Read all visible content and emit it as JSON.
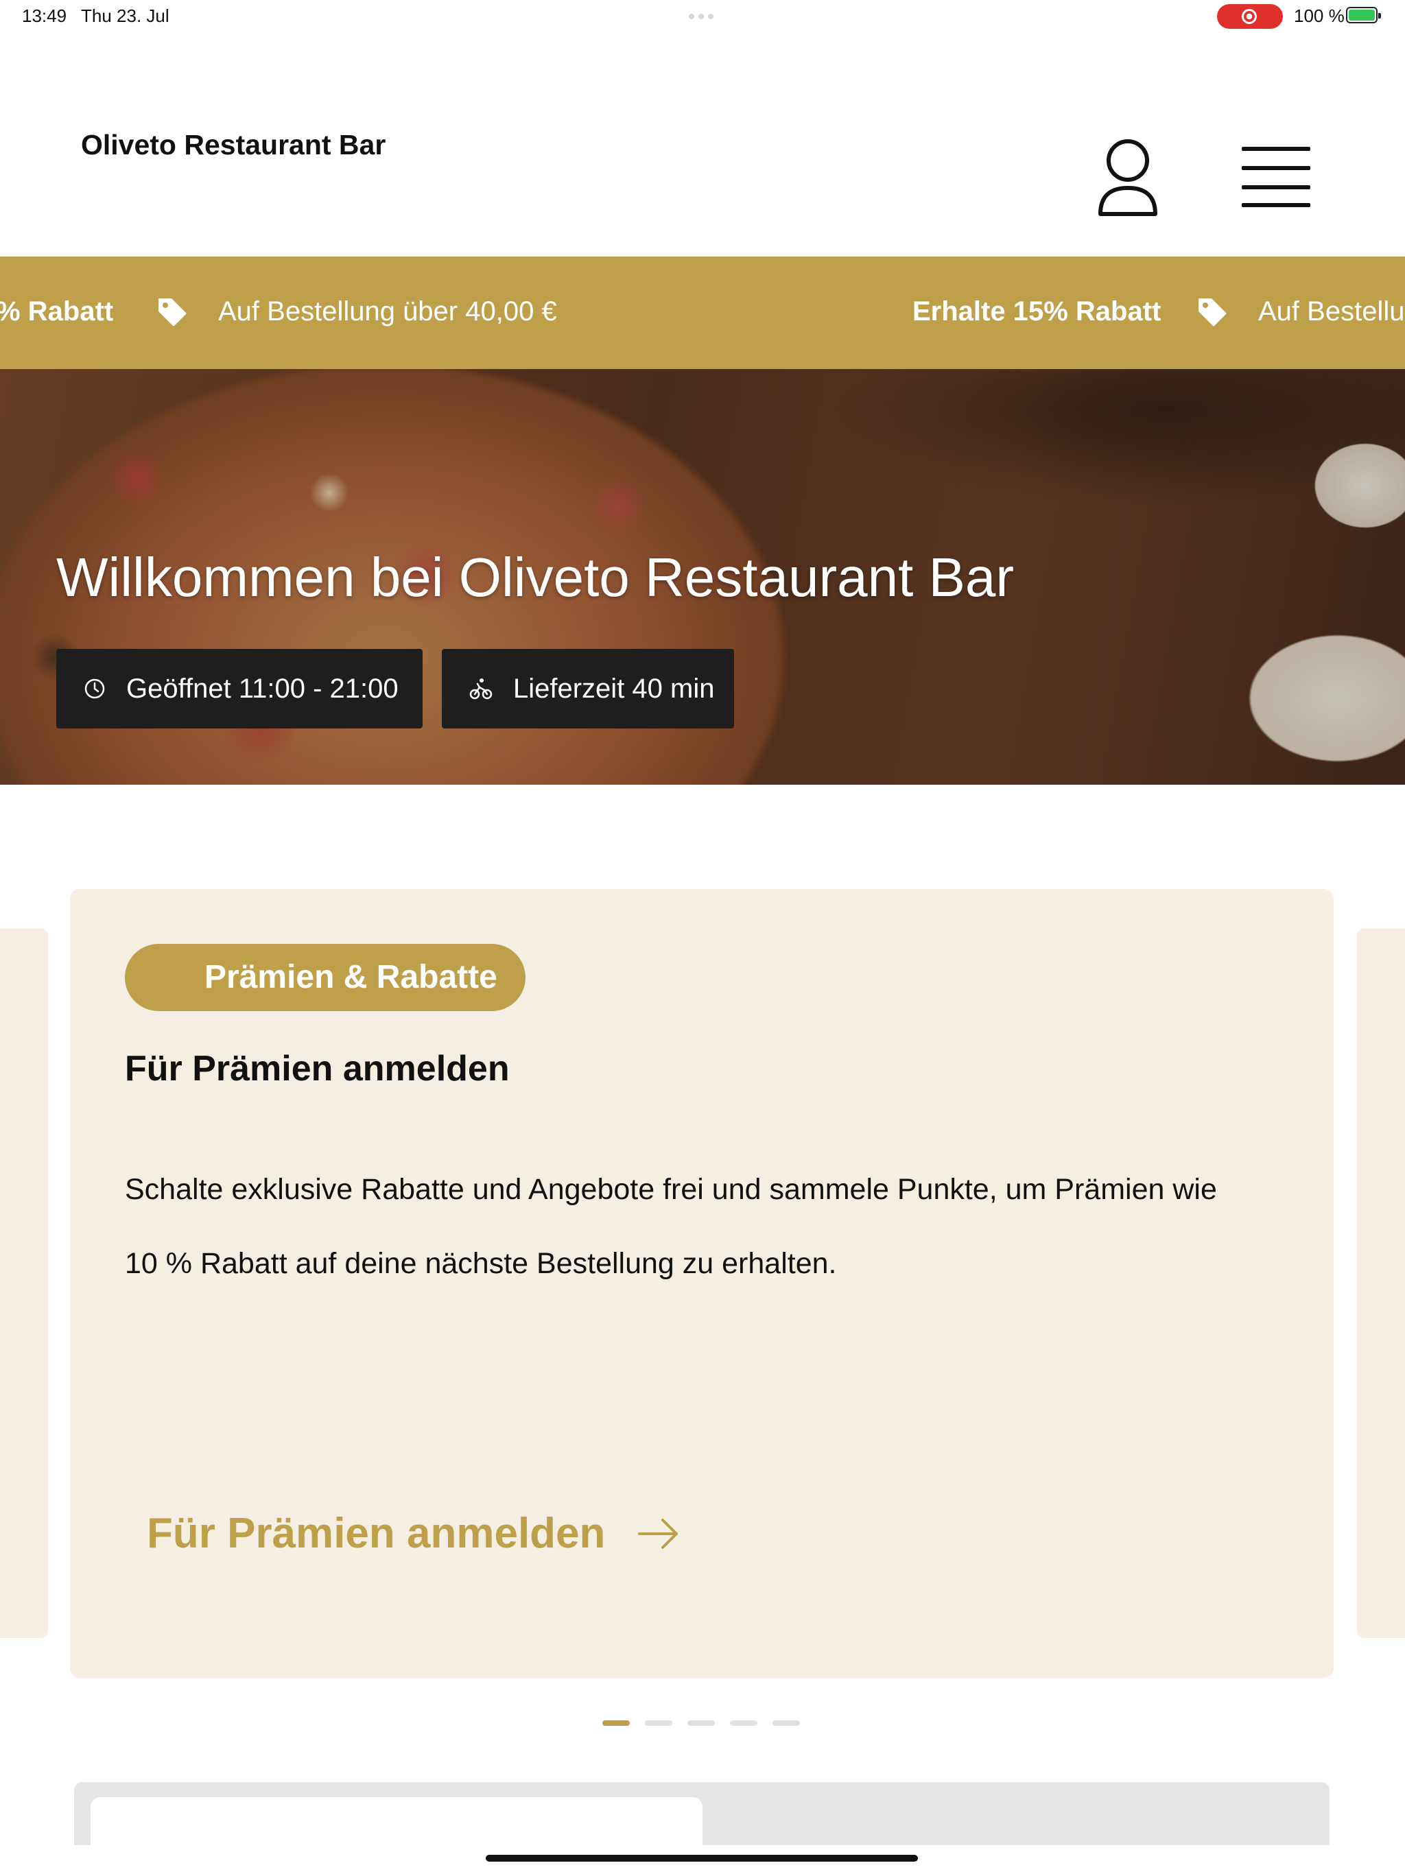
{
  "status_bar": {
    "time": "13:49",
    "date": "Thu 23. Jul",
    "battery": "100 %"
  },
  "header": {
    "brand": "Oliveto Restaurant Bar",
    "icons": [
      "user-icon",
      "menu-icon"
    ]
  },
  "ticker": {
    "items": [
      {
        "bold": "% Rabatt",
        "text": "Auf Bestellung über 40,00 €"
      },
      {
        "bold": "Erhalte 15% Rabatt",
        "text": "Auf Bestellu"
      }
    ]
  },
  "hero": {
    "title": "Willkommen bei Oliveto Restaurant Bar",
    "opening_hours": "Geöffnet 11:00 - 21:00",
    "delivery_time": "Lieferzeit 40 min"
  },
  "rewards_card": {
    "badge": "Prämien & Rabatte",
    "title": "Für Prämien anmelden",
    "body_line1": "Schalte exklusive Rabatte und Angebote frei und sammele Punkte, um Prämien wie",
    "body_line2": "10 % Rabatt auf deine nächste Bestellung zu erhalten.",
    "cta": "Für Prämien anmelden"
  },
  "carousel": {
    "slides": 5,
    "active_index": 0
  },
  "colors": {
    "accent": "#bea04a",
    "card_bg": "#f4efe2",
    "pill_bg": "#1e1e1e"
  }
}
